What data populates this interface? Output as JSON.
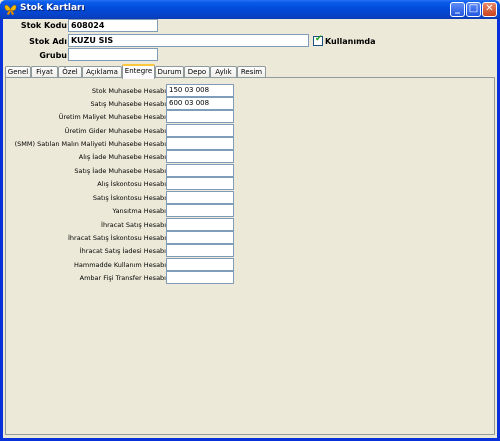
{
  "window": {
    "title": "Stok Kartları",
    "icon": "butterfly-icon",
    "buttons": {
      "minimize": "_",
      "maximize": "□",
      "close": "✕"
    }
  },
  "header": {
    "stok_kodu_label": "Stok Kodu",
    "stok_kodu_value": "608024",
    "stok_adi_label": "Stok Adı",
    "stok_adi_value": "KUZU SIS",
    "grubu_label": "Grubu",
    "grubu_value": "",
    "kullanimda_label": "Kullanımda",
    "kullanimda_checked": true
  },
  "tabs": [
    "Genel",
    "Fiyat",
    "Özel",
    "Açıklama",
    "Entegre",
    "Durum",
    "Depo",
    "Aylık",
    "Resim"
  ],
  "active_tab": "Entegre",
  "entegre": {
    "rows": [
      {
        "label": "Stok Muhasebe Hesabı",
        "value": "150 03 008"
      },
      {
        "label": "Satış Muhasebe Hesabı",
        "value": "600 03 008"
      },
      {
        "label": "Üretim Maliyet Muhasebe Hesabı",
        "value": ""
      },
      {
        "label": "Üretim Gider Muhasebe Hesabı",
        "value": ""
      },
      {
        "label": "(SMM) Satılan Malın Maliyeti Muhasebe Hesabı",
        "value": ""
      },
      {
        "label": "Alış İade Muhasebe Hesabı",
        "value": ""
      },
      {
        "label": "Satış İade Muhasebe Hesabı",
        "value": ""
      },
      {
        "label": "Alış İskontosu Hesabı",
        "value": ""
      },
      {
        "label": "Satış İskontosu Hesabı",
        "value": ""
      },
      {
        "label": "Yansıtma Hesabı",
        "value": ""
      },
      {
        "label": "İhracat Satış Hesabı",
        "value": ""
      },
      {
        "label": "İhracat Satış İskontosu Hesabı",
        "value": ""
      },
      {
        "label": "İhracat Satış İadesi Hesabı",
        "value": ""
      },
      {
        "label": "Hammadde Kullanım Hesabı",
        "value": ""
      },
      {
        "label": "Ambar Fişi Transfer Hesabı",
        "value": ""
      }
    ]
  },
  "colors": {
    "titlebar": "#0a5bea",
    "tab_active_accent": "#ffc83c",
    "field_border": "#7f9db9"
  }
}
